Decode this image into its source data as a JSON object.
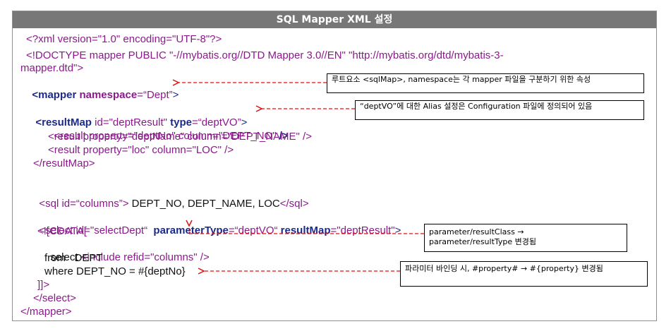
{
  "header": {
    "title": "SQL Mapper XML 설정"
  },
  "code": {
    "l1": [
      "<?xml version=\"1.0\" encoding=\"UTF-8\"?>"
    ],
    "l2": [
      "<!DOCTYPE mapper PUBLIC \"-//mybatis.org//DTD Mapper 3.0//EN\" \"http://mybatis.org/dtd/mybatis-3-"
    ],
    "l3": [
      "mapper.dtd\">"
    ],
    "l4": {
      "tag": "<mapper ",
      "attr": "namespace",
      "eq": "=",
      "val": "“Dept”",
      "close": ">"
    },
    "l5": {
      "tag": "<resultMap ",
      "a1": "id",
      "v1": "=\"deptResult\" ",
      "a2": "type",
      "v2": "=“deptVO”",
      "close": ">"
    },
    "l6": {
      "text": "<result property=\"deptNo\" column=\"DEPT_NO\" ",
      "close": "/>"
    },
    "l7": {
      "text": "<result property=\"deptName\" column=\"DEPT_NAME\" />"
    },
    "l8": {
      "text": "<result property=\"loc\" column=\"LOC\" />"
    },
    "l9": {
      "text": "</resultMap>"
    },
    "l10": {
      "tag": "<sql id=“columns”>",
      "body": " DEPT_NO, DEPT_NAME, LOC",
      "close": "</sql>"
    },
    "l11": {
      "tag": "<select id=\"selectDept“  ",
      "a1": "parameterType",
      "v1": "=“deptVO“ ",
      "a2": "resultMap",
      "v2": "=\"deptResult\"",
      "close": ">"
    },
    "l12": {
      "text": "<![CDATA["
    },
    "l13": {
      "pre": "select ",
      "tag": "<include refid=\"columns\" />"
    },
    "l14": {
      "text": "from   DEPT"
    },
    "l15": {
      "text": "where DEPT_NO = #{deptNo}"
    },
    "l16": {
      "text": "]]>"
    },
    "l17": {
      "text": "</select>"
    },
    "l18": {
      "text": "</mapper>"
    }
  },
  "notes": {
    "n1": "루트요소 <sqlMap>, namespace는 각 mapper 파일을 구분하기 위한 속성",
    "n2": "“deptVO”에 대한 Alias 설정은 Configuration 파일에 정의되어 있음",
    "n3": "parameter/resultClass →\nparameter/resultType 변경됨",
    "n4": "파라미터 바인딩 시, #property# → #{property} 변경됨"
  },
  "colors": {
    "header_bg": "#777777",
    "arrow": "#e01010",
    "purple": "#8a1a8a",
    "navy": "#1c2a8a"
  }
}
